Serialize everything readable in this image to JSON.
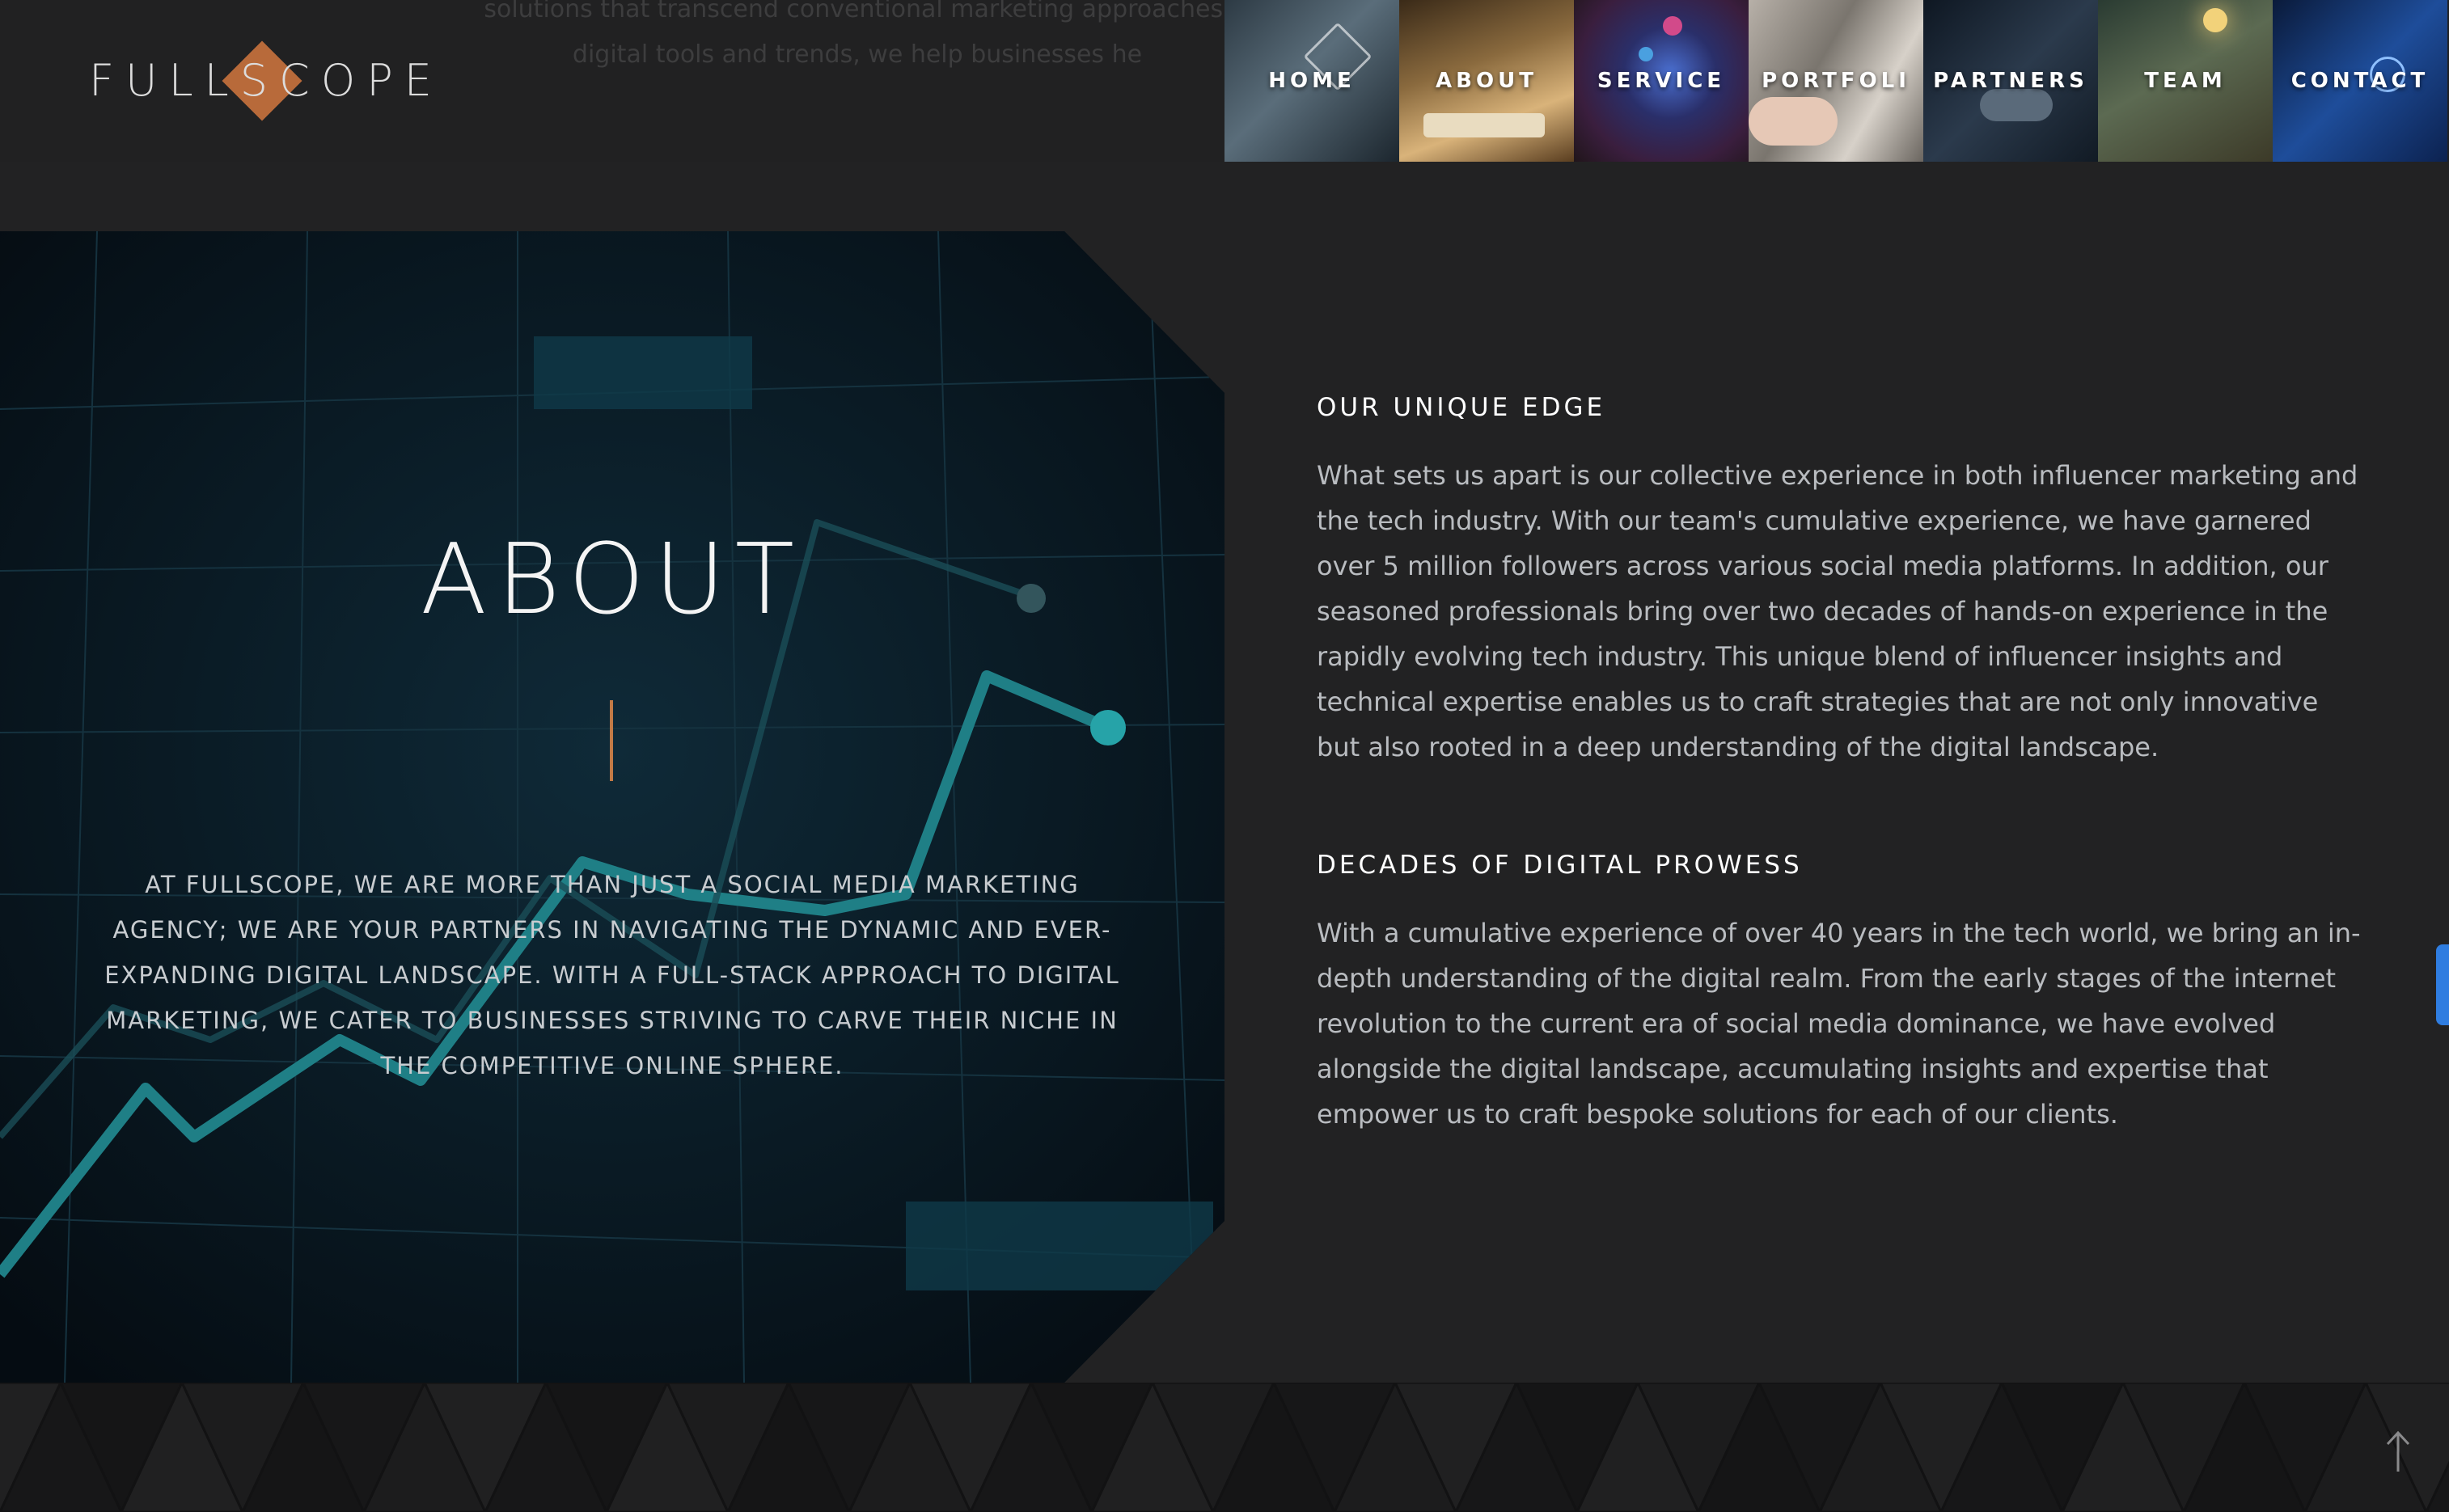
{
  "header": {
    "faded_text_line1": "solutions that transcend conventional marketing approaches.",
    "faded_text_line2": "digital tools and trends, we help businesses he",
    "logo_text": "FULLSCOPE"
  },
  "nav": {
    "items": [
      {
        "label": "HOME"
      },
      {
        "label": "ABOUT"
      },
      {
        "label": "SERVICE"
      },
      {
        "label": "PORTFOLI"
      },
      {
        "label": "PARTNERS"
      },
      {
        "label": "TEAM"
      },
      {
        "label": "CONTACT"
      }
    ]
  },
  "about": {
    "title": "ABOUT",
    "text": "AT FULLSCOPE, WE ARE MORE THAN JUST A SOCIAL MEDIA MARKETING AGENCY; WE ARE YOUR PARTNERS IN NAVIGATING THE DYNAMIC AND EVER-EXPANDING DIGITAL LANDSCAPE. WITH A FULL-STACK APPROACH TO DIGITAL MARKETING, WE CATER TO BUSINESSES STRIVING TO CARVE THEIR NICHE IN THE COMPETITIVE ONLINE SPHERE."
  },
  "sections": [
    {
      "heading": "OUR UNIQUE EDGE",
      "body": "What sets us apart is our collective experience in both influencer marketing and the tech industry. With our team's cumulative experience, we have garnered over 5 million followers across various social media platforms. In addition, our seasoned professionals bring over two decades of hands-on experience in the rapidly evolving tech industry. This unique blend of influencer insights and technical expertise enables us to craft strategies that are not only innovative but also rooted in a deep understanding of the digital landscape."
    },
    {
      "heading": "DECADES OF DIGITAL PROWESS",
      "body": "With a cumulative experience of over 40 years in the tech world, we bring an in-depth understanding of the digital realm. From the early stages of the internet revolution to the current era of social media dominance, we have evolved alongside the digital landscape, accumulating insights and expertise that empower us to craft bespoke solutions for each of our clients."
    }
  ],
  "colors": {
    "accent": "#b86a3a",
    "background": "#222223",
    "side_tab": "#2f7de0"
  },
  "icons": {
    "scroll_top": "arrow-up-icon"
  }
}
